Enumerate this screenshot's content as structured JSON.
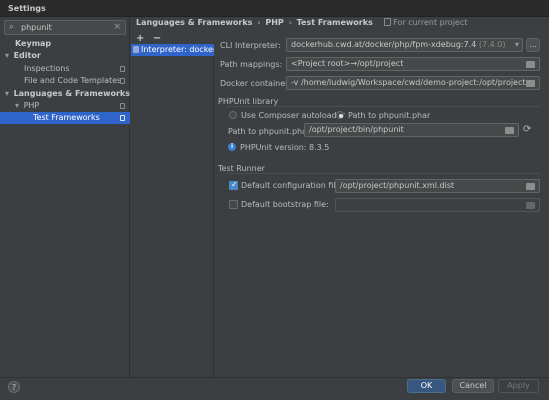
{
  "window": {
    "title": "Settings"
  },
  "search": {
    "value": "phpunit"
  },
  "sidebar": {
    "items": [
      {
        "label": "Keymap"
      },
      {
        "label": "Editor"
      },
      {
        "label": "Inspections"
      },
      {
        "label": "File and Code Templates"
      },
      {
        "label": "Languages & Frameworks"
      },
      {
        "label": "PHP"
      },
      {
        "label": "Test Frameworks"
      }
    ]
  },
  "header": {
    "crumb1": "Languages & Frameworks",
    "sep": "›",
    "crumb2": "PHP",
    "crumb3": "Test Frameworks",
    "for_project": "For current project"
  },
  "list": {
    "toolbar_add": "+",
    "toolbar_remove": "−",
    "interpreter": "Interpreter: docker"
  },
  "form": {
    "cli_label": "CLI Interpreter:",
    "cli_value": "dockerhub.cwd.at/docker/php/fpm-xdebug:7.4",
    "cli_version": "(7.4.0)",
    "cli_more": "...",
    "path_mappings_label": "Path mappings:",
    "path_mappings_value": "<Project root>→/opt/project",
    "docker_label": "Docker container:",
    "docker_value": "-v /home/ludwig/Workspace/cwd/demo-project:/opt/project",
    "phpunit_section": "PHPUnit library",
    "radio_composer": "Use Composer autoloader",
    "radio_phar": "Path to phpunit.phar",
    "phar_label": "Path to phpunit.phar:",
    "phar_value": "/opt/project/bin/phpunit",
    "phpunit_version": "PHPUnit version: 8.3.5",
    "runner_section": "Test Runner",
    "default_config_label": "Default configuration file:",
    "default_config_value": "/opt/project/phpunit.xml.dist",
    "default_bootstrap_label": "Default bootstrap file:"
  },
  "buttons": {
    "ok": "OK",
    "cancel": "Cancel",
    "apply": "Apply",
    "help": "?"
  },
  "colors": {
    "accent": "#2f65ca",
    "background": "#3c3f41",
    "primary_button": "#365880"
  }
}
